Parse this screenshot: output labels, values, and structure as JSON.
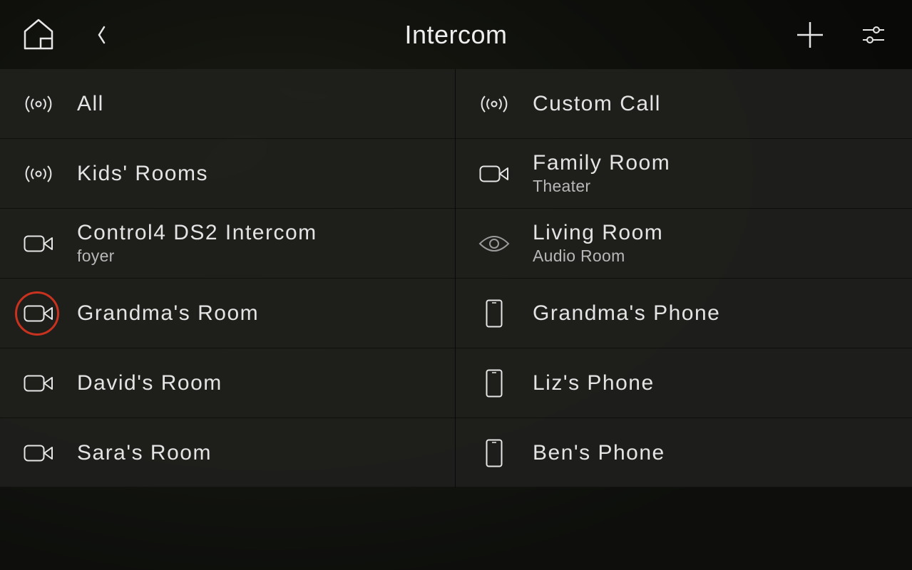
{
  "header": {
    "title": "Intercom",
    "home_icon": "home-icon",
    "back_icon": "chevron-left-icon",
    "add_icon": "plus-icon",
    "settings_icon": "sliders-icon"
  },
  "colors": {
    "selected_ring": "#c8321e",
    "text": "#e4e4e4",
    "subtext": "#b8b8b8"
  },
  "left": [
    {
      "name": "All",
      "sub": "",
      "icon": "broadcast-icon"
    },
    {
      "name": "Kids' Rooms",
      "sub": "",
      "icon": "broadcast-icon"
    },
    {
      "name": "Control4 DS2 Intercom",
      "sub": "foyer",
      "icon": "video-camera-icon"
    },
    {
      "name": "Grandma's Room",
      "sub": "",
      "icon": "video-camera-icon",
      "selected": true
    },
    {
      "name": "David's Room",
      "sub": "",
      "icon": "video-camera-icon"
    },
    {
      "name": "Sara's Room",
      "sub": "",
      "icon": "video-camera-icon"
    }
  ],
  "right": [
    {
      "name": "Custom Call",
      "sub": "",
      "icon": "broadcast-icon"
    },
    {
      "name": "Family Room",
      "sub": "Theater",
      "icon": "video-camera-icon"
    },
    {
      "name": "Living Room",
      "sub": "Audio Room",
      "icon": "eye-icon"
    },
    {
      "name": "Grandma's Phone",
      "sub": "",
      "icon": "phone-icon"
    },
    {
      "name": "Liz's Phone",
      "sub": "",
      "icon": "phone-icon"
    },
    {
      "name": "Ben's Phone",
      "sub": "",
      "icon": "phone-icon"
    }
  ]
}
